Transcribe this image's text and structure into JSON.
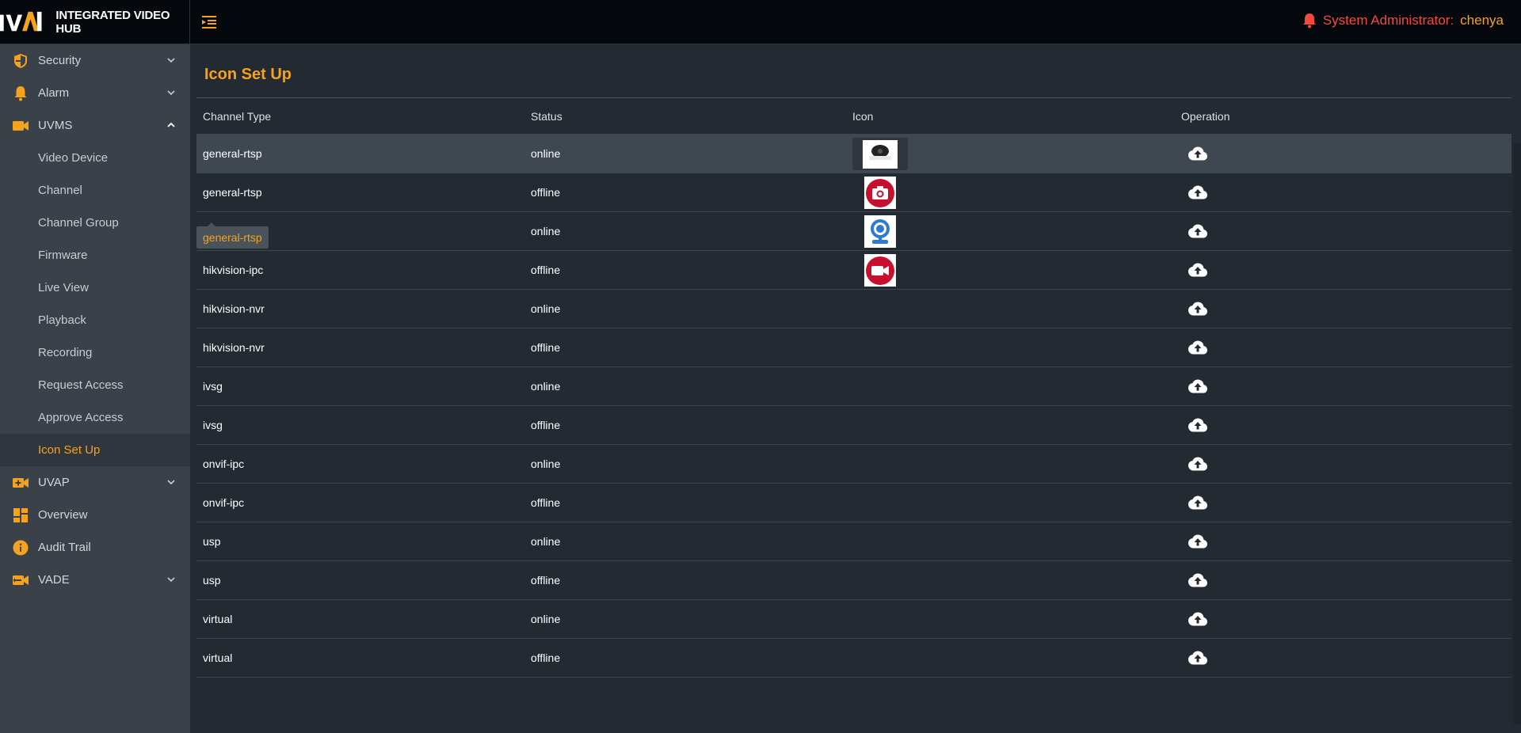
{
  "app": {
    "name": "INTEGRATED VIDEO HUB",
    "logo_text": "IVAH"
  },
  "header": {
    "role": "System Administrator:",
    "user": "chenya"
  },
  "sidebar": {
    "items": [
      {
        "label": "Security",
        "icon": "shield-icon"
      },
      {
        "label": "Alarm",
        "icon": "bell-icon"
      },
      {
        "label": "UVMS",
        "icon": "video-camera-icon"
      }
    ],
    "uvms_sub": [
      "Video Device",
      "Channel",
      "Channel Group",
      "Firmware",
      "Live View",
      "Playback",
      "Recording",
      "Request Access",
      "Approve Access",
      "Icon Set Up"
    ],
    "bottom_items": [
      {
        "label": "UVAP",
        "icon": "video-add-icon"
      },
      {
        "label": "Overview",
        "icon": "dashboard-icon"
      },
      {
        "label": "Audit Trail",
        "icon": "info-icon"
      },
      {
        "label": "VADE",
        "icon": "video-link-icon"
      }
    ]
  },
  "page": {
    "title": "Icon Set Up"
  },
  "table": {
    "headers": [
      "Channel Type",
      "Status",
      "Icon",
      "Operation"
    ],
    "rows": [
      {
        "type": "general-rtsp",
        "status": "online",
        "icon": "dome-camera-thumb"
      },
      {
        "type": "general-rtsp",
        "status": "offline",
        "icon": "red-camera-icon"
      },
      {
        "type": "general-rtsp",
        "status": "online",
        "icon": "blue-webcam-icon"
      },
      {
        "type": "hikvision-ipc",
        "status": "offline",
        "icon": "red-video-icon"
      },
      {
        "type": "hikvision-nvr",
        "status": "online"
      },
      {
        "type": "hikvision-nvr",
        "status": "offline"
      },
      {
        "type": "ivsg",
        "status": "online"
      },
      {
        "type": "ivsg",
        "status": "offline"
      },
      {
        "type": "onvif-ipc",
        "status": "online"
      },
      {
        "type": "onvif-ipc",
        "status": "offline"
      },
      {
        "type": "usp",
        "status": "online"
      },
      {
        "type": "usp",
        "status": "offline"
      },
      {
        "type": "virtual",
        "status": "online"
      },
      {
        "type": "virtual",
        "status": "offline"
      }
    ]
  },
  "colors": {
    "accent": "#f7a21b",
    "alert": "#f5493b",
    "header_bg": "#05080c",
    "sidebar_bg": "#3a4149",
    "content_bg": "#232a31"
  }
}
